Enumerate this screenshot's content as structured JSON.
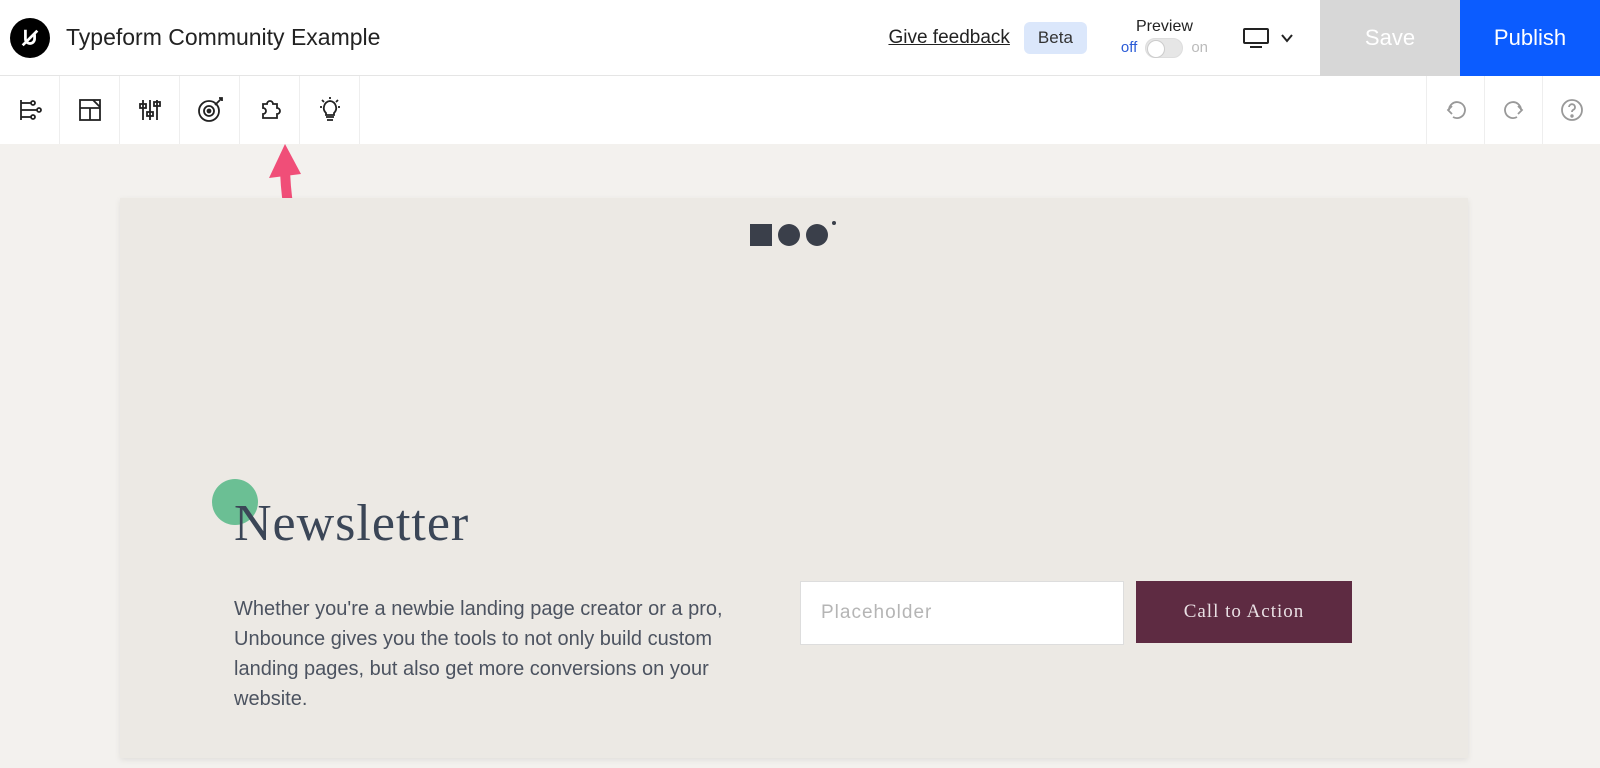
{
  "header": {
    "title": "Typeform Community Example",
    "feedback_label": "Give feedback",
    "beta_label": "Beta",
    "preview_label": "Preview",
    "preview_off": "off",
    "preview_on": "on",
    "save_label": "Save",
    "publish_label": "Publish"
  },
  "toolbar_icons": {
    "structure": "structure-icon",
    "style": "style-icon",
    "sliders": "sliders-icon",
    "goals": "goals-icon",
    "puzzle": "puzzle-icon",
    "idea": "idea-icon",
    "undo": "undo-icon",
    "redo": "redo-icon",
    "help": "help-icon"
  },
  "canvas": {
    "heading": "Newsletter",
    "body": "Whether you're a newbie landing page creator or a pro, Unbounce gives you the tools to not only build custom landing pages, but also get more conversions on your website.",
    "input_placeholder": "Placeholder",
    "cta_label": "Call to Action"
  },
  "palette": {
    "green_accent": "#6bbf94",
    "cta_bg": "#5e2b42",
    "canvas_bg": "#ece9e4",
    "stage_bg": "#f3f1ee",
    "publish_blue": "#0b5cff"
  }
}
